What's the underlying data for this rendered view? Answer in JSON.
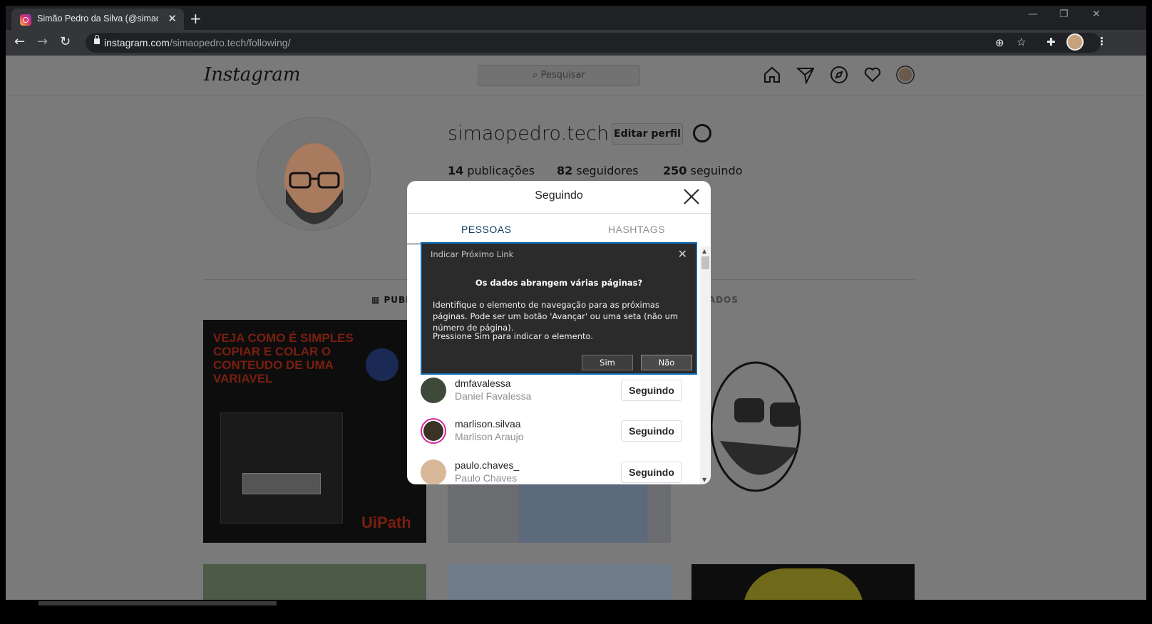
{
  "browser": {
    "tab_title": "Simão Pedro da Silva (@simaope",
    "tab_close": "✕",
    "new_tab": "+",
    "url_host": "instagram.com",
    "url_path": "/simaopedro.tech/following/",
    "window_controls": [
      "—",
      "❐",
      "✕"
    ]
  },
  "instagram": {
    "logo": "Instagram",
    "search_placeholder": "Pesquisar",
    "nav_icons": [
      "home-icon",
      "direct-icon",
      "explore-icon",
      "heart-icon",
      "profile-icon"
    ]
  },
  "profile": {
    "username": "simaopedro.tech",
    "edit_label": "Editar perfil",
    "posts_count": "14",
    "posts_label": "publicações",
    "followers_count": "82",
    "followers_label": "seguidores",
    "following_count": "250",
    "following_label": "seguindo",
    "tab_posts": "PUBL",
    "tab_tagged": "CADOS"
  },
  "posts": {
    "tile1_text": "VEJA COMO É SIMPLES COPIAR E COLAR O CONTEUDO DE UMA VARIAVEL",
    "tile1_brand": "UiPath"
  },
  "modal": {
    "title": "Seguindo",
    "tab_people": "PESSOAS",
    "tab_hashtags": "HASHTAGS",
    "users": [
      {
        "username": "dmfavalessa",
        "fullname": "Daniel Favalessa",
        "button": "Seguindo"
      },
      {
        "username": "marlison.silvaa",
        "fullname": "Marlison Araujo",
        "button": "Seguindo"
      },
      {
        "username": "paulo.chaves_",
        "fullname": "Paulo Chaves",
        "button": "Seguindo"
      }
    ]
  },
  "dialog": {
    "title": "Indicar Próximo Link",
    "question": "Os dados abrangem várias páginas?",
    "text1": "Identifique o elemento de navegação para as próximas páginas. Pode ser um botão 'Avançar' ou uma seta (não um número de página).",
    "text2": "Pressione Sim para indicar o elemento.",
    "yes": "Sim",
    "no": "Não"
  },
  "colors": {
    "dialog_border": "#0f6ab4",
    "overlay": "#7a7a7a",
    "modal_tab_active": "#262626"
  }
}
